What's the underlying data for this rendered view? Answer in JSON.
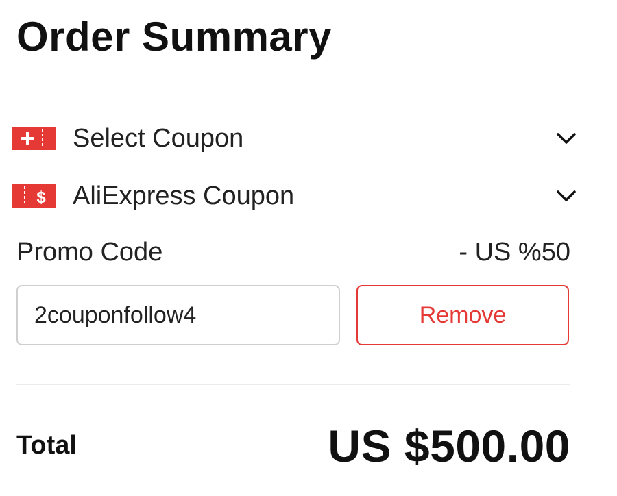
{
  "title": "Order Summary",
  "coupons": [
    {
      "label": "Select Coupon",
      "icon": "coupon-ticket-icon"
    },
    {
      "label": "AliExpress Coupon",
      "icon": "dollar-coupon-icon"
    }
  ],
  "promo": {
    "label": "Promo Code",
    "discount": "- US %50",
    "input_value": "2couponfollow4",
    "remove_label": "Remove"
  },
  "total": {
    "label": "Total",
    "value": "US $500.00"
  },
  "colors": {
    "accent": "#e53935",
    "border": "#cfcfcf",
    "divider": "#ececec"
  }
}
